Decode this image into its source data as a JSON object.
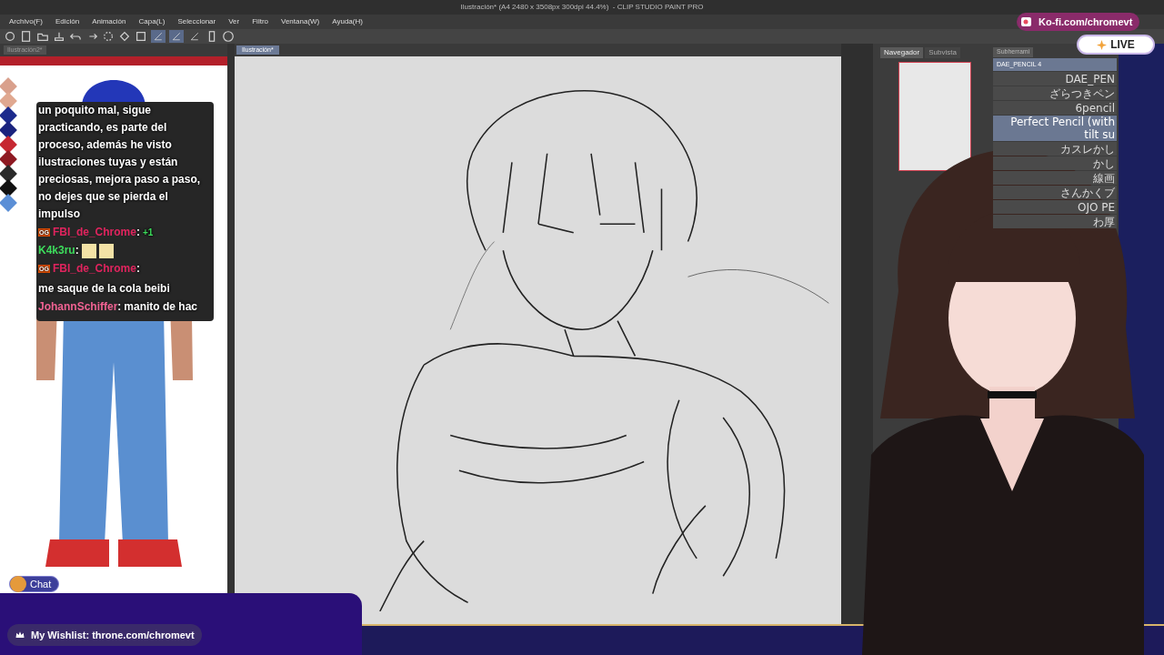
{
  "window": {
    "title": "Ilustración* (A4 2480 x 3508px 300dpi 44.4%)  - CLIP STUDIO PAINT PRO"
  },
  "menu": [
    "Archivo(F)",
    "Edición",
    "Animación",
    "Capa(L)",
    "Seleccionar",
    "Ver",
    "Filtro",
    "Ventana(W)",
    "Ayuda(H)"
  ],
  "pen_tools": [
    {
      "selected": true
    },
    {
      "selected": true
    },
    {
      "selected": false
    }
  ],
  "tabs": [
    {
      "label": "Ilustración2*",
      "selected": false
    },
    {
      "label": "Ilustración*",
      "selected": true
    }
  ],
  "palette": [
    {
      "color": "#d9a08c"
    },
    {
      "color": "#e0a890"
    },
    {
      "color": "#1c2a8c"
    },
    {
      "color": "#1a237e"
    },
    {
      "color": "#c62832"
    },
    {
      "color": "#8e1a22"
    },
    {
      "color": "#2a2a2a"
    },
    {
      "color": "#111111"
    },
    {
      "color": "#5b8fd6"
    }
  ],
  "chat": {
    "messages": [
      {
        "text": "un poquito mal, sigue practicando, es parte del proceso, además he visto ilustraciones tuyas y están preciosas, mejora paso a paso, no dejes que se pierda el impulso"
      },
      {
        "badge": "OG",
        "user": "FBI_de_Chrome",
        "separator": ":",
        "color": "#e0245e",
        "text": "+1",
        "kind": "repost"
      },
      {
        "user": "K4k3ru",
        "separator": ":",
        "color": "#3ddc5c",
        "kind": "emotes"
      },
      {
        "badge": "OG",
        "user": "FBI_de_Chrome",
        "separator": ":",
        "color": "#e0245e",
        "text": "me saque de la cola beibi",
        "kind": "text"
      },
      {
        "user": "JohannSchiffer",
        "separator": ":",
        "color": "#f06292",
        "text": "manito de hac",
        "kind": "text"
      }
    ],
    "button": "Chat"
  },
  "navigator": {
    "tabs": [
      {
        "label": "Navegador",
        "selected": true
      },
      {
        "label": "Subvista",
        "selected": false
      }
    ]
  },
  "sub_tool": {
    "tab": "Subherrami",
    "group": "DAE_PENCIL 4",
    "brushes": [
      {
        "name": "DAE_PEN",
        "selected": false
      },
      {
        "name": "ざらつきペン",
        "selected": false
      },
      {
        "name": "6pencil",
        "selected": false
      },
      {
        "name": "Perfect Pencil (with tilt su",
        "selected": true
      },
      {
        "name": "カスレかし",
        "selected": false
      },
      {
        "name": "かし",
        "selected": false
      },
      {
        "name": "線画",
        "selected": false
      },
      {
        "name": "さんかくブ",
        "selected": false
      },
      {
        "name": "OJO PE",
        "selected": false
      },
      {
        "name": "わ厚",
        "selected": false
      }
    ]
  },
  "overlay": {
    "kofi": "Ko-fi.com/chromevt",
    "live": "LIVE",
    "wishlist": "My Wishlist: throne.com/chromevt"
  }
}
